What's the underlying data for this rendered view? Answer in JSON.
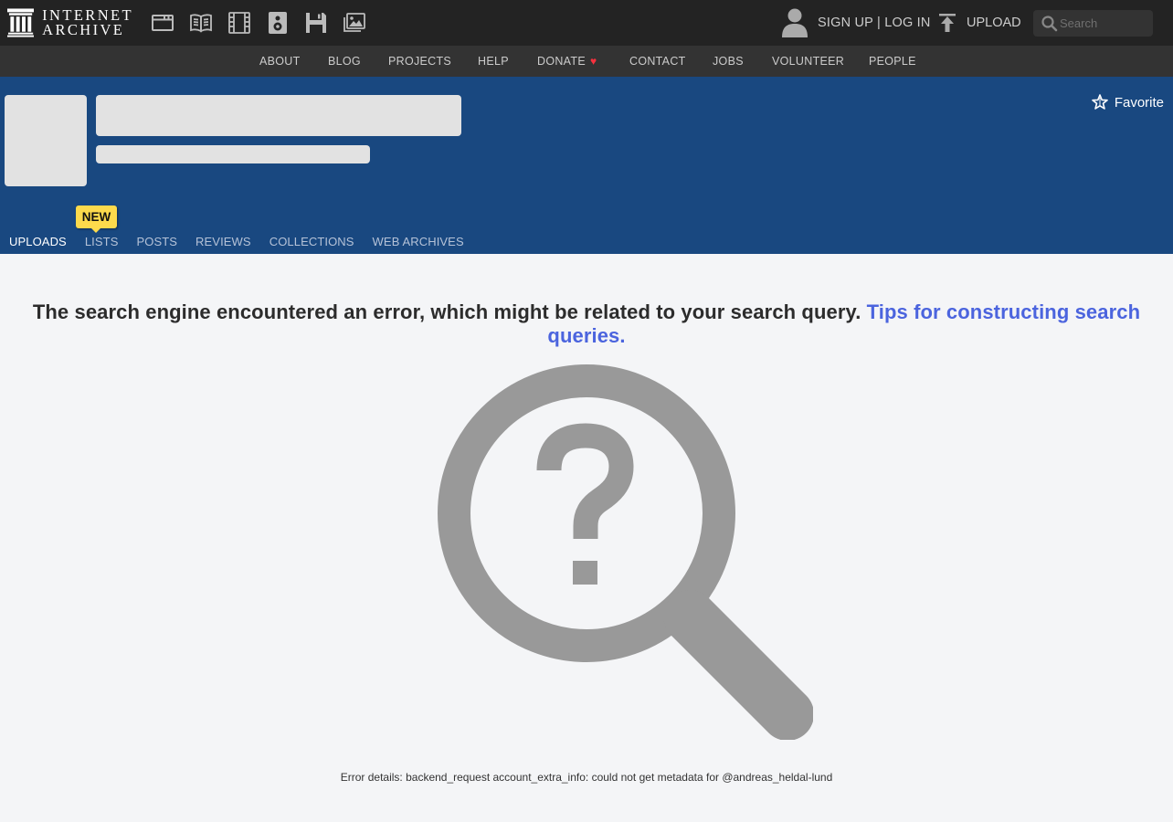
{
  "header": {
    "logo_line1": "INTERNET",
    "logo_line2": "ARCHIVE",
    "media_icons": [
      "web-icon",
      "texts-icon",
      "video-icon",
      "audio-icon",
      "software-icon",
      "images-icon"
    ],
    "sign_up": "SIGN UP",
    "separator": "|",
    "log_in": "LOG IN",
    "upload": "UPLOAD",
    "search_placeholder": "Search"
  },
  "nav": {
    "items": [
      "ABOUT",
      "BLOG",
      "PROJECTS",
      "HELP",
      "DONATE",
      "CONTACT",
      "JOBS",
      "VOLUNTEER",
      "PEOPLE"
    ],
    "donate_heart": "♥"
  },
  "profile": {
    "favorite": "Favorite",
    "new_badge": "NEW",
    "tabs": [
      "UPLOADS",
      "LISTS",
      "POSTS",
      "REVIEWS",
      "COLLECTIONS",
      "WEB ARCHIVES"
    ],
    "active_tab": "UPLOADS"
  },
  "error": {
    "message": "The search engine encountered an error, which might be related to your search query.",
    "tips_link": "Tips for constructing search queries.",
    "details": "Error details: backend_request account_extra_info: could not get metadata for @andreas_heldal-lund"
  },
  "colors": {
    "topbar": "#232323",
    "subnav": "#333333",
    "profile_bg": "#194880",
    "link": "#4b64de",
    "badge": "#fdda4c",
    "heart": "#f6313e"
  }
}
